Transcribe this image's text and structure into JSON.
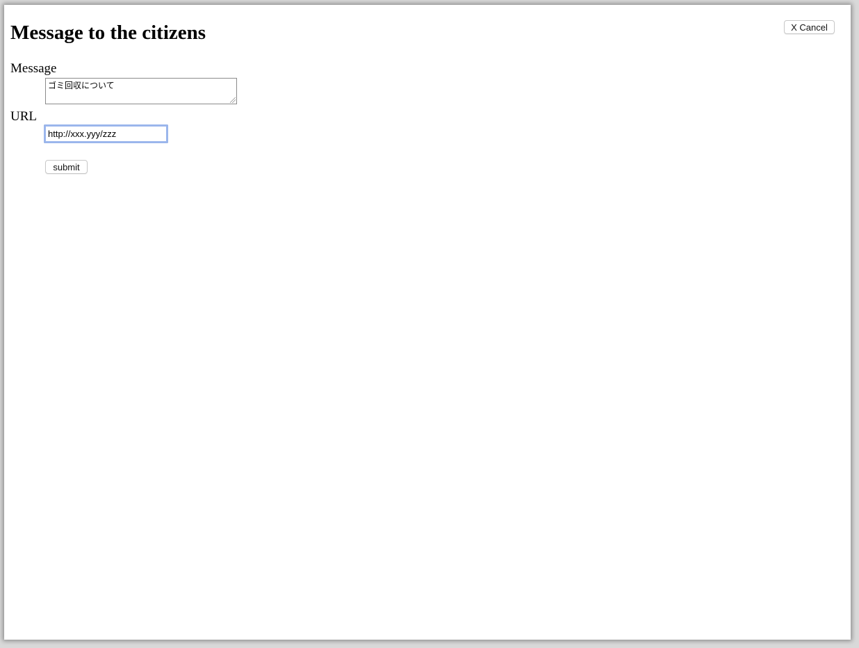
{
  "page": {
    "title": "Message to the citizens",
    "cancel_label": "X Cancel"
  },
  "form": {
    "message_label": "Message",
    "message_value": "ゴミ回収について",
    "url_label": "URL",
    "url_value": "http://xxx.yyy/zzz",
    "submit_label": "submit"
  },
  "colors": {
    "focus_ring": "#9bb6ec",
    "background": "#ffffff"
  }
}
